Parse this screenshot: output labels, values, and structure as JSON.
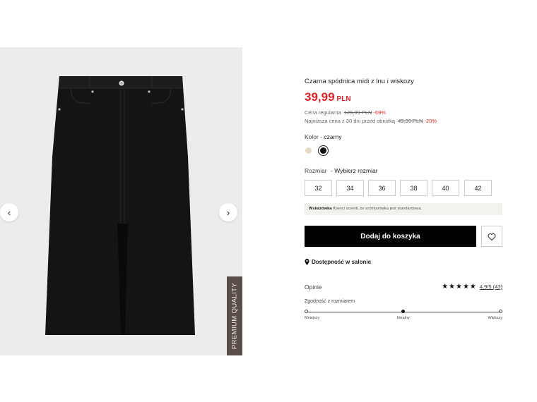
{
  "gallery": {
    "badge": "PREMIUM QUALITY",
    "prev_icon": "chevron-left-icon",
    "next_icon": "chevron-right-icon",
    "background": "#ececec"
  },
  "product": {
    "title": "Czarna spódnica midi z lnu i wiskozy",
    "price": "39,99",
    "currency": "PLN",
    "regular_label": "Cena regularna",
    "regular_price": "129,99 PLN",
    "regular_discount": "-69%",
    "lowest_label": "Najniższa cena z 30 dni przed obniżką",
    "lowest_price": "49,99 PLN",
    "lowest_discount": "-20%",
    "accent_color": "#d8232a"
  },
  "color": {
    "label": "Kolor",
    "value": "czarny",
    "swatches": [
      "#e4dcc8",
      "#111111"
    ]
  },
  "size": {
    "label": "Rozmiar",
    "value": "Wybierz rozmiar",
    "options": [
      "32",
      "34",
      "36",
      "38",
      "40",
      "42"
    ]
  },
  "fit_note": {
    "bold": "Wskazówka",
    "text": "Klienci ocenili, że rozmiarówka jest standardowa."
  },
  "actions": {
    "add_to_cart": "Dodaj do koszyka",
    "wishlist_icon": "heart-icon",
    "store_availability": "Dostępność w salonie",
    "store_icon": "map-pin-icon"
  },
  "reviews": {
    "label": "Opinie",
    "rating_stars": 5,
    "score": "4,9/5 (43)",
    "fit_label": "Zgodność z rozmiarem",
    "fit_left": "Mniejszy",
    "fit_mid": "Idealny",
    "fit_right": "Większy",
    "fit_position": 0.5
  }
}
